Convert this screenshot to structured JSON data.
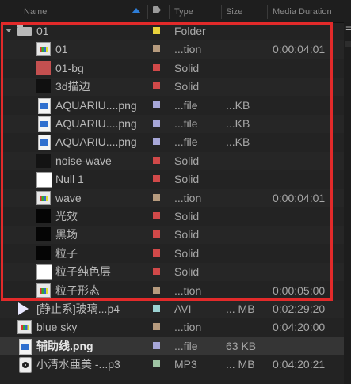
{
  "header": {
    "name": "Name",
    "type": "Type",
    "size": "Size",
    "duration": "Media Duration"
  },
  "label_colors": {
    "yellow": "#e8d23c",
    "tan": "#b69b7e",
    "red": "#d14949",
    "lavender": "#a7a7d8",
    "aqua": "#9bd2d2",
    "sea": "#9ec3a3"
  },
  "rows": [
    {
      "name": "01",
      "type": "Folder",
      "size": "",
      "duration": "",
      "label": "yellow",
      "icon": "folder-icon"
    },
    {
      "name": "01",
      "type": "...tion",
      "size": "",
      "duration": "0:00:04:01",
      "label": "tan",
      "icon": "composition-icon"
    },
    {
      "name": "01-bg",
      "type": "Solid",
      "size": "",
      "duration": "",
      "label": "red",
      "icon": "solid-swatch"
    },
    {
      "name": "3d描边",
      "type": "Solid",
      "size": "",
      "duration": "",
      "label": "red",
      "icon": "solid-swatch"
    },
    {
      "name": "AQUARIU....png",
      "type": "...file",
      "size": "...KB",
      "duration": "",
      "label": "lavender",
      "icon": "png-file-icon"
    },
    {
      "name": "AQUARIU....png",
      "type": "...file",
      "size": "...KB",
      "duration": "",
      "label": "lavender",
      "icon": "png-file-icon"
    },
    {
      "name": "AQUARIU....png",
      "type": "...file",
      "size": "...KB",
      "duration": "",
      "label": "lavender",
      "icon": "png-file-icon"
    },
    {
      "name": "noise-wave",
      "type": "Solid",
      "size": "",
      "duration": "",
      "label": "red",
      "icon": "solid-swatch"
    },
    {
      "name": "Null 1",
      "type": "Solid",
      "size": "",
      "duration": "",
      "label": "red",
      "icon": "solid-swatch"
    },
    {
      "name": "wave",
      "type": "...tion",
      "size": "",
      "duration": "0:00:04:01",
      "label": "tan",
      "icon": "composition-icon"
    },
    {
      "name": "光效",
      "type": "Solid",
      "size": "",
      "duration": "",
      "label": "red",
      "icon": "solid-swatch"
    },
    {
      "name": "黑场",
      "type": "Solid",
      "size": "",
      "duration": "",
      "label": "red",
      "icon": "solid-swatch"
    },
    {
      "name": "粒子",
      "type": "Solid",
      "size": "",
      "duration": "",
      "label": "red",
      "icon": "solid-swatch"
    },
    {
      "name": "粒子纯色层",
      "type": "Solid",
      "size": "",
      "duration": "",
      "label": "red",
      "icon": "solid-swatch"
    },
    {
      "name": "粒子形态",
      "type": "...tion",
      "size": "",
      "duration": "0:00:05:00",
      "label": "tan",
      "icon": "composition-icon"
    },
    {
      "name": "[静止系]玻璃...p4",
      "type": "AVI",
      "size": "... MB",
      "duration": "0:02:29:20",
      "label": "aqua",
      "icon": "video-file-icon"
    },
    {
      "name": "blue sky",
      "type": "...tion",
      "size": "",
      "duration": "0:04:20:00",
      "label": "tan",
      "icon": "composition-icon"
    },
    {
      "name": "辅助线.png",
      "type": "...file",
      "size": "63 KB",
      "duration": "",
      "label": "lavender",
      "icon": "png-file-icon"
    },
    {
      "name": "小清水亜美 -...p3",
      "type": "MP3",
      "size": "... MB",
      "duration": "0:04:20:21",
      "label": "sea",
      "icon": "audio-file-icon"
    }
  ]
}
